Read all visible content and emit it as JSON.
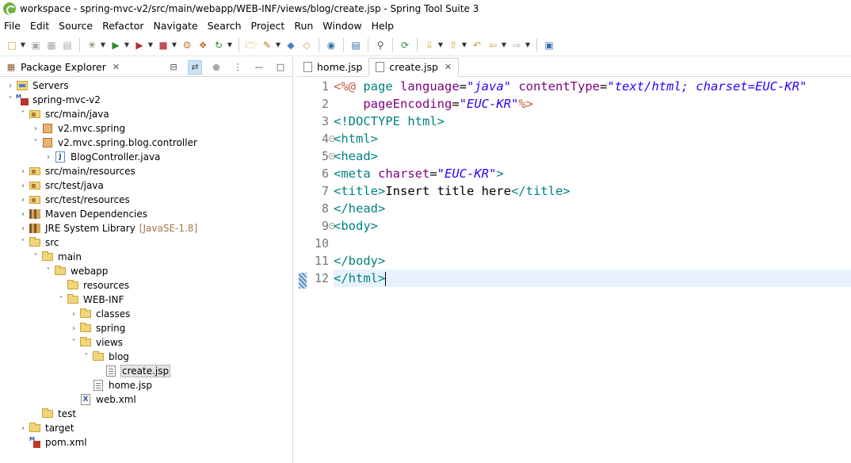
{
  "window": {
    "title": "workspace - spring-mvc-v2/src/main/webapp/WEB-INF/views/blog/create.jsp - Spring Tool Suite 3"
  },
  "menu": [
    "File",
    "Edit",
    "Source",
    "Refactor",
    "Navigate",
    "Search",
    "Project",
    "Run",
    "Window",
    "Help"
  ],
  "explorer": {
    "tab_label": "Package Explorer",
    "tab_close": "✕",
    "tree": [
      {
        "label": "Servers",
        "twisty": "›",
        "icon": "servers"
      },
      {
        "label": "spring-mvc-v2",
        "twisty": "˅",
        "icon": "project"
      },
      {
        "label": "src/main/java",
        "twisty": "˅",
        "icon": "srcfolder"
      },
      {
        "label": "v2.mvc.spring",
        "twisty": "›",
        "icon": "package"
      },
      {
        "label": "v2.mvc.spring.blog.controller",
        "twisty": "˅",
        "icon": "package"
      },
      {
        "label": "BlogController.java",
        "twisty": "›",
        "icon": "java"
      },
      {
        "label": "src/main/resources",
        "twisty": "›",
        "icon": "srcfolder"
      },
      {
        "label": "src/test/java",
        "twisty": "›",
        "icon": "srcfolder"
      },
      {
        "label": "src/test/resources",
        "twisty": "›",
        "icon": "srcfolder"
      },
      {
        "label": "Maven Dependencies",
        "twisty": "›",
        "icon": "library"
      },
      {
        "label": "JRE System Library",
        "twisty": "›",
        "icon": "library",
        "decoration": "[JavaSE-1.8]"
      },
      {
        "label": "src",
        "twisty": "˅",
        "icon": "folder"
      },
      {
        "label": "main",
        "twisty": "˅",
        "icon": "folder"
      },
      {
        "label": "webapp",
        "twisty": "˅",
        "icon": "folder"
      },
      {
        "label": "resources",
        "twisty": "",
        "icon": "folder"
      },
      {
        "label": "WEB-INF",
        "twisty": "˅",
        "icon": "folder"
      },
      {
        "label": "classes",
        "twisty": "›",
        "icon": "folder"
      },
      {
        "label": "spring",
        "twisty": "›",
        "icon": "folder"
      },
      {
        "label": "views",
        "twisty": "˅",
        "icon": "folder"
      },
      {
        "label": "blog",
        "twisty": "˅",
        "icon": "folder"
      },
      {
        "label": "create.jsp",
        "twisty": "",
        "icon": "jsp",
        "selected": true
      },
      {
        "label": "home.jsp",
        "twisty": "",
        "icon": "jsp"
      },
      {
        "label": "web.xml",
        "twisty": "",
        "icon": "xml"
      },
      {
        "label": "test",
        "twisty": "",
        "icon": "folder"
      },
      {
        "label": "target",
        "twisty": "›",
        "icon": "folder"
      },
      {
        "label": "pom.xml",
        "twisty": "",
        "icon": "pom"
      }
    ]
  },
  "editor": {
    "tabs": [
      {
        "label": "home.jsp",
        "active": false
      },
      {
        "label": "create.jsp",
        "active": true
      }
    ],
    "tab_close": "✕",
    "current_line": 12,
    "lines": [
      {
        "num": "1",
        "fold": false
      },
      {
        "num": "2",
        "fold": false
      },
      {
        "num": "3",
        "fold": false
      },
      {
        "num": "4",
        "fold": true
      },
      {
        "num": "5",
        "fold": true
      },
      {
        "num": "6",
        "fold": false
      },
      {
        "num": "7",
        "fold": false
      },
      {
        "num": "8",
        "fold": false
      },
      {
        "num": "9",
        "fold": true
      },
      {
        "num": "10",
        "fold": false
      },
      {
        "num": "11",
        "fold": false
      },
      {
        "num": "12",
        "fold": false
      }
    ],
    "code": {
      "l1": {
        "open": "<%@",
        "kw": " page ",
        "a1": "language",
        "eq1": "=",
        "v1": "\"java\"",
        "a2": " contentType",
        "eq2": "=",
        "v2": "\"text/html; charset=EUC-KR\""
      },
      "l2": {
        "indent": "    ",
        "a1": "pageEncoding",
        "eq1": "=",
        "v1": "\"EUC-KR\"",
        "close": "%>"
      },
      "l3": {
        "text": "<!DOCTYPE html>"
      },
      "l4": {
        "text": "<html>"
      },
      "l5": {
        "text": "<head>"
      },
      "l6": {
        "tag": "<meta",
        "a1": " charset",
        "eq1": "=",
        "v1": "\"EUC-KR\"",
        "close": ">"
      },
      "l7": {
        "t1": "<title>",
        "body": "Insert title here",
        "t2": "</title>"
      },
      "l8": {
        "text": "</head>"
      },
      "l9": {
        "text": "<body>"
      },
      "l10": {
        "text": ""
      },
      "l11": {
        "text": "</body>"
      },
      "l12": {
        "text": "</html>"
      }
    }
  }
}
